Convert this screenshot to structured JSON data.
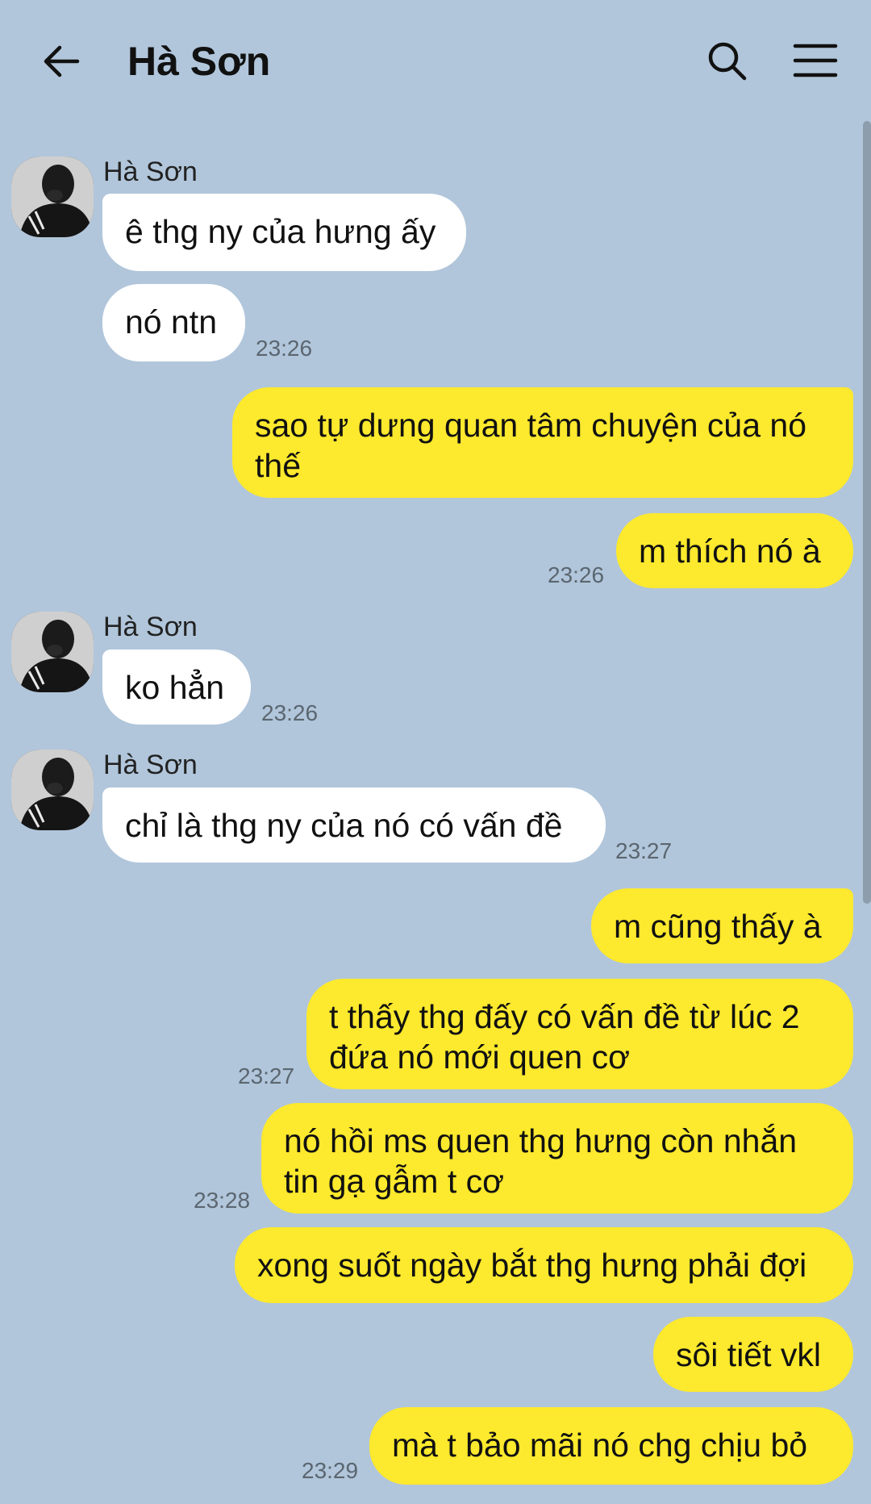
{
  "header": {
    "title": "Hà Sơn",
    "back_icon": "arrow-left-icon",
    "search_icon": "search-icon",
    "menu_icon": "hamburger-menu-icon"
  },
  "contact": {
    "name": "Hà Sơn"
  },
  "colors": {
    "background": "#b1c6db",
    "incoming_bubble": "#ffffff",
    "outgoing_bubble": "#fde92d"
  },
  "messages": [
    {
      "dir": "in",
      "text": "ê thg ny của hưng ấy",
      "time": ""
    },
    {
      "dir": "in",
      "text": "nó ntn",
      "time": "23:26"
    },
    {
      "dir": "out",
      "text": "sao tự dưng quan tâm chuyện của nó thế",
      "time": ""
    },
    {
      "dir": "out",
      "text": "m thích nó à",
      "time": "23:26"
    },
    {
      "dir": "in",
      "text": "ko hẳn",
      "time": "23:26"
    },
    {
      "dir": "in",
      "text": "chỉ là thg ny của nó có vấn đề",
      "time": "23:27"
    },
    {
      "dir": "out",
      "text": "m cũng thấy à",
      "time": ""
    },
    {
      "dir": "out",
      "text": "t thấy thg đấy có vấn đề từ lúc 2 đứa nó mới quen cơ",
      "time": "23:27"
    },
    {
      "dir": "out",
      "text": "nó hồi ms quen thg hưng còn nhắn tin gạ gẫm t cơ",
      "time": "23:28"
    },
    {
      "dir": "out",
      "text": "xong suốt ngày bắt thg hưng phải đợi",
      "time": ""
    },
    {
      "dir": "out",
      "text": "sôi tiết vkl",
      "time": ""
    },
    {
      "dir": "out",
      "text": "mà t bảo mãi nó chg chịu bỏ",
      "time": "23:29"
    }
  ]
}
